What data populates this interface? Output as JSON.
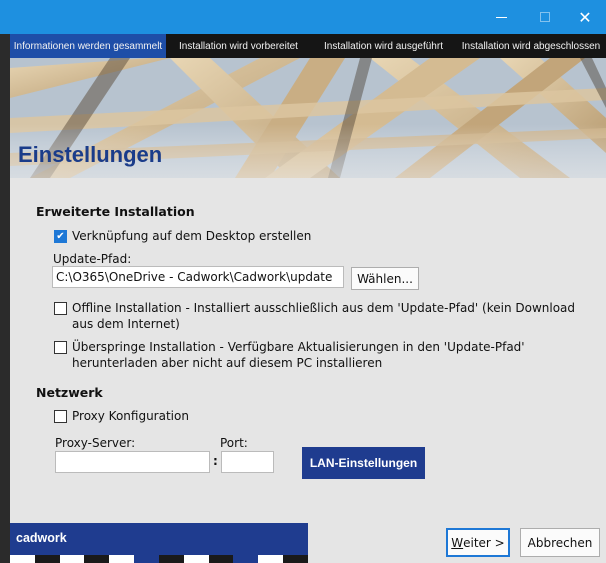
{
  "steps": [
    {
      "label": "Informationen werden gesammelt",
      "active": true
    },
    {
      "label": "Installation wird vorbereitet",
      "active": false
    },
    {
      "label": "Installation wird ausgeführt",
      "active": false
    },
    {
      "label": "Installation wird abgeschlossen",
      "active": false
    }
  ],
  "banner": {
    "title": "Einstellungen"
  },
  "advanced": {
    "section_title": "Erweiterte Installation",
    "desktop_shortcut": {
      "label": "Verknüpfung auf dem Desktop erstellen",
      "checked": true
    },
    "update_path_label": "Update-Pfad:",
    "update_path_value": "C:\\O365\\OneDrive - Cadwork\\Cadwork\\update",
    "browse_label": "Wählen...",
    "offline": {
      "label_line1": "Offline Installation - Installiert ausschließlich aus dem 'Update-Pfad' (kein Download",
      "label_line2": "aus dem Internet)",
      "checked": false
    },
    "skip": {
      "label_line1": "Überspringe Installation - Verfügbare Aktualisierungen in den 'Update-Pfad'",
      "label_line2": "herunterladen aber nicht auf diesem PC installieren",
      "checked": false
    }
  },
  "network": {
    "section_title": "Netzwerk",
    "proxy_config": {
      "label": "Proxy Konfiguration",
      "checked": false
    },
    "proxy_server_label": "Proxy-Server:",
    "port_label": "Port:",
    "colon": ":",
    "proxy_server_value": "",
    "port_value": "",
    "lan_button_label": "LAN-Einstellungen"
  },
  "footer": {
    "brand": "cadwork",
    "next_label_underlined": "W",
    "next_label_rest": "eiter >",
    "cancel_label": "Abbrechen"
  },
  "window": {
    "close_glyph": "✕"
  },
  "colors": {
    "titlebar": "#1e90e0",
    "step_active": "#1e4ea8",
    "brand_blue": "#1f3c8f",
    "banner_title": "#1a3c8a",
    "checkbox_checked": "#1e78d6"
  },
  "icons": {
    "minimize": "minimize-icon",
    "maximize": "maximize-icon",
    "close": "close-icon",
    "check": "checkmark-icon"
  }
}
